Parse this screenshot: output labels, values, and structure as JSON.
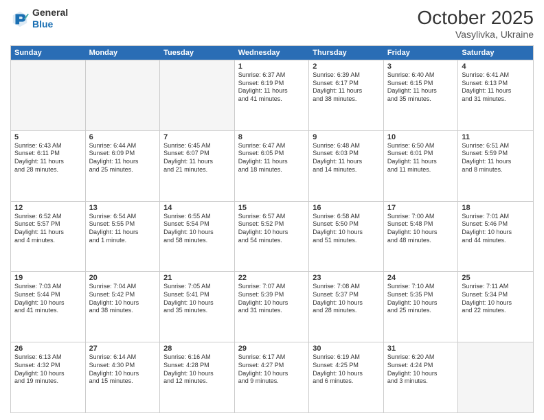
{
  "header": {
    "logo_general": "General",
    "logo_blue": "Blue",
    "month": "October 2025",
    "location": "Vasylivka, Ukraine"
  },
  "days_of_week": [
    "Sunday",
    "Monday",
    "Tuesday",
    "Wednesday",
    "Thursday",
    "Friday",
    "Saturday"
  ],
  "weeks": [
    [
      {
        "num": "",
        "info": ""
      },
      {
        "num": "",
        "info": ""
      },
      {
        "num": "",
        "info": ""
      },
      {
        "num": "1",
        "info": "Sunrise: 6:37 AM\nSunset: 6:19 PM\nDaylight: 11 hours\nand 41 minutes."
      },
      {
        "num": "2",
        "info": "Sunrise: 6:39 AM\nSunset: 6:17 PM\nDaylight: 11 hours\nand 38 minutes."
      },
      {
        "num": "3",
        "info": "Sunrise: 6:40 AM\nSunset: 6:15 PM\nDaylight: 11 hours\nand 35 minutes."
      },
      {
        "num": "4",
        "info": "Sunrise: 6:41 AM\nSunset: 6:13 PM\nDaylight: 11 hours\nand 31 minutes."
      }
    ],
    [
      {
        "num": "5",
        "info": "Sunrise: 6:43 AM\nSunset: 6:11 PM\nDaylight: 11 hours\nand 28 minutes."
      },
      {
        "num": "6",
        "info": "Sunrise: 6:44 AM\nSunset: 6:09 PM\nDaylight: 11 hours\nand 25 minutes."
      },
      {
        "num": "7",
        "info": "Sunrise: 6:45 AM\nSunset: 6:07 PM\nDaylight: 11 hours\nand 21 minutes."
      },
      {
        "num": "8",
        "info": "Sunrise: 6:47 AM\nSunset: 6:05 PM\nDaylight: 11 hours\nand 18 minutes."
      },
      {
        "num": "9",
        "info": "Sunrise: 6:48 AM\nSunset: 6:03 PM\nDaylight: 11 hours\nand 14 minutes."
      },
      {
        "num": "10",
        "info": "Sunrise: 6:50 AM\nSunset: 6:01 PM\nDaylight: 11 hours\nand 11 minutes."
      },
      {
        "num": "11",
        "info": "Sunrise: 6:51 AM\nSunset: 5:59 PM\nDaylight: 11 hours\nand 8 minutes."
      }
    ],
    [
      {
        "num": "12",
        "info": "Sunrise: 6:52 AM\nSunset: 5:57 PM\nDaylight: 11 hours\nand 4 minutes."
      },
      {
        "num": "13",
        "info": "Sunrise: 6:54 AM\nSunset: 5:55 PM\nDaylight: 11 hours\nand 1 minute."
      },
      {
        "num": "14",
        "info": "Sunrise: 6:55 AM\nSunset: 5:54 PM\nDaylight: 10 hours\nand 58 minutes."
      },
      {
        "num": "15",
        "info": "Sunrise: 6:57 AM\nSunset: 5:52 PM\nDaylight: 10 hours\nand 54 minutes."
      },
      {
        "num": "16",
        "info": "Sunrise: 6:58 AM\nSunset: 5:50 PM\nDaylight: 10 hours\nand 51 minutes."
      },
      {
        "num": "17",
        "info": "Sunrise: 7:00 AM\nSunset: 5:48 PM\nDaylight: 10 hours\nand 48 minutes."
      },
      {
        "num": "18",
        "info": "Sunrise: 7:01 AM\nSunset: 5:46 PM\nDaylight: 10 hours\nand 44 minutes."
      }
    ],
    [
      {
        "num": "19",
        "info": "Sunrise: 7:03 AM\nSunset: 5:44 PM\nDaylight: 10 hours\nand 41 minutes."
      },
      {
        "num": "20",
        "info": "Sunrise: 7:04 AM\nSunset: 5:42 PM\nDaylight: 10 hours\nand 38 minutes."
      },
      {
        "num": "21",
        "info": "Sunrise: 7:05 AM\nSunset: 5:41 PM\nDaylight: 10 hours\nand 35 minutes."
      },
      {
        "num": "22",
        "info": "Sunrise: 7:07 AM\nSunset: 5:39 PM\nDaylight: 10 hours\nand 31 minutes."
      },
      {
        "num": "23",
        "info": "Sunrise: 7:08 AM\nSunset: 5:37 PM\nDaylight: 10 hours\nand 28 minutes."
      },
      {
        "num": "24",
        "info": "Sunrise: 7:10 AM\nSunset: 5:35 PM\nDaylight: 10 hours\nand 25 minutes."
      },
      {
        "num": "25",
        "info": "Sunrise: 7:11 AM\nSunset: 5:34 PM\nDaylight: 10 hours\nand 22 minutes."
      }
    ],
    [
      {
        "num": "26",
        "info": "Sunrise: 6:13 AM\nSunset: 4:32 PM\nDaylight: 10 hours\nand 19 minutes."
      },
      {
        "num": "27",
        "info": "Sunrise: 6:14 AM\nSunset: 4:30 PM\nDaylight: 10 hours\nand 15 minutes."
      },
      {
        "num": "28",
        "info": "Sunrise: 6:16 AM\nSunset: 4:28 PM\nDaylight: 10 hours\nand 12 minutes."
      },
      {
        "num": "29",
        "info": "Sunrise: 6:17 AM\nSunset: 4:27 PM\nDaylight: 10 hours\nand 9 minutes."
      },
      {
        "num": "30",
        "info": "Sunrise: 6:19 AM\nSunset: 4:25 PM\nDaylight: 10 hours\nand 6 minutes."
      },
      {
        "num": "31",
        "info": "Sunrise: 6:20 AM\nSunset: 4:24 PM\nDaylight: 10 hours\nand 3 minutes."
      },
      {
        "num": "",
        "info": ""
      }
    ]
  ]
}
